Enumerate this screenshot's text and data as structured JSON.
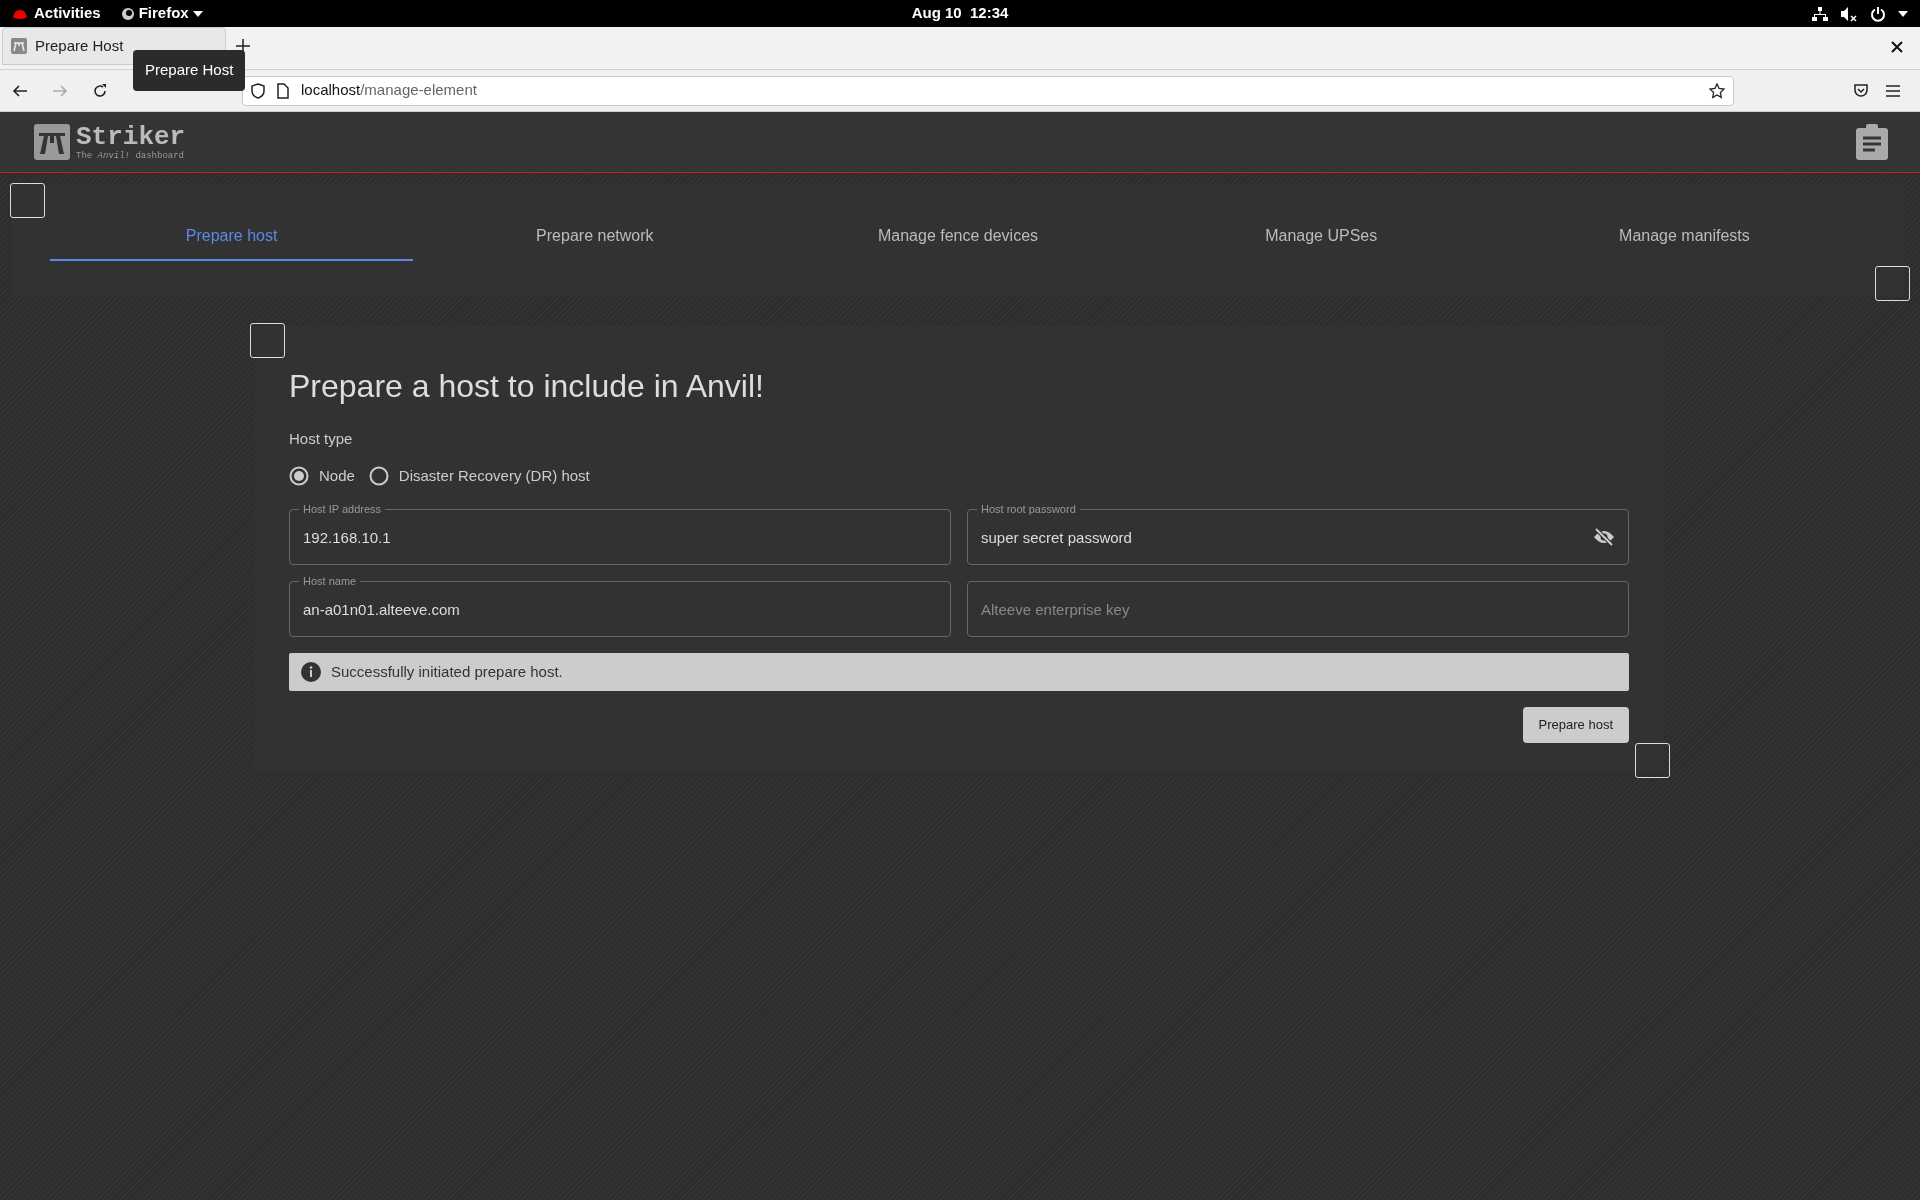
{
  "system_bar": {
    "activities": "Activities",
    "app_menu": "Firefox",
    "clock": "Aug 10  12:34"
  },
  "browser": {
    "tab_title": "Prepare Host",
    "tooltip": "Prepare Host",
    "url_host": "localhost",
    "url_path": "/manage-element"
  },
  "app_header": {
    "title": "Striker",
    "subtitle": "The *Anvil!* dashboard"
  },
  "tabs": [
    {
      "label": "Prepare host",
      "selected": true
    },
    {
      "label": "Prepare network",
      "selected": false
    },
    {
      "label": "Manage fence devices",
      "selected": false
    },
    {
      "label": "Manage UPSes",
      "selected": false
    },
    {
      "label": "Manage manifests",
      "selected": false
    }
  ],
  "form": {
    "heading": "Prepare a host to include in Anvil!",
    "host_type_label": "Host type",
    "host_types": [
      {
        "label": "Node",
        "selected": true
      },
      {
        "label": "Disaster Recovery (DR) host",
        "selected": false
      }
    ],
    "fields": [
      {
        "kind": "text",
        "label": "Host IP address",
        "value": "192.168.10.1"
      },
      {
        "kind": "password",
        "label": "Host root password",
        "value": "super secret password"
      },
      {
        "kind": "text",
        "label": "Host name",
        "value": "an-a01n01.alteeve.com"
      },
      {
        "kind": "text",
        "placeholder": "Alteeve enterprise key"
      }
    ],
    "alert": {
      "text": "Successfully initiated prepare host."
    },
    "submit_button": "Prepare host"
  }
}
